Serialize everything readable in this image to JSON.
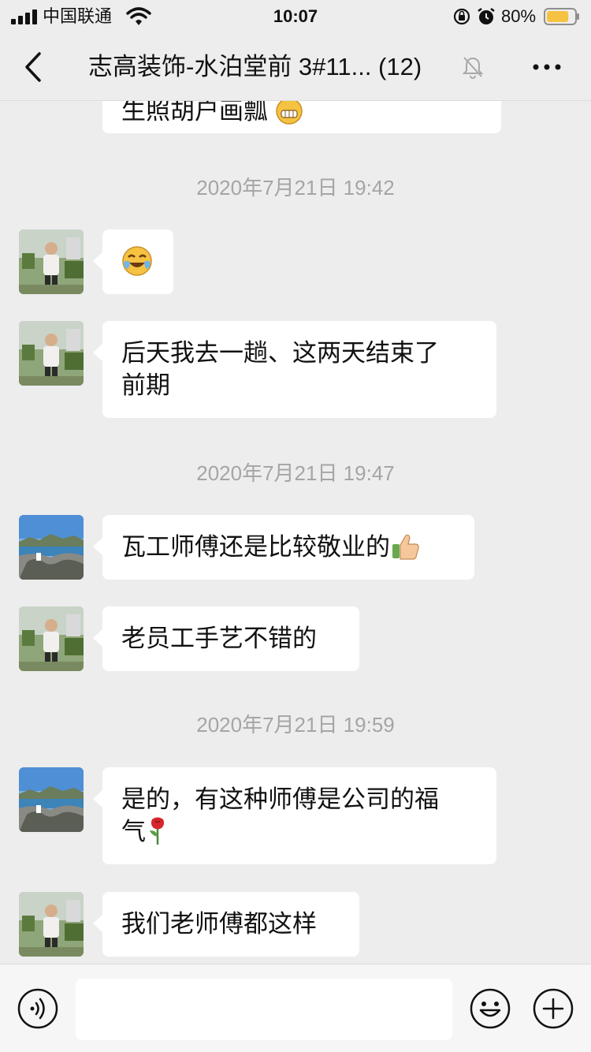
{
  "status_bar": {
    "carrier": "中国联通",
    "time": "10:07",
    "battery_percent": "80%",
    "battery_level": 0.8,
    "battery_color": "#f5c242"
  },
  "nav": {
    "title": "志高装饰-水泊堂前 3#11... (12)",
    "back_icon": "chevron-left-icon",
    "mute_icon": "bell-muted-icon",
    "more_icon": "more-dots-icon"
  },
  "messages": {
    "partial_top": {
      "text": "生照胡户画瓢",
      "emoji": "grin-emoji"
    },
    "ts1": "2020年7月21日 19:42",
    "m1": {
      "sender_avatar": "avatar-man",
      "emoji": "crying-laughing-emoji"
    },
    "m2": {
      "sender_avatar": "avatar-man",
      "line1": "后天我去一趟、这两天结束了",
      "line2": "前期"
    },
    "ts2": "2020年7月21日 19:47",
    "m3": {
      "sender_avatar": "avatar-seaside",
      "text": "瓦工师傅还是比较敬业的",
      "emoji": "thumbs-up-emoji"
    },
    "m4": {
      "sender_avatar": "avatar-man",
      "text": "老员工手艺不错的"
    },
    "ts3": "2020年7月21日 19:59",
    "m5": {
      "sender_avatar": "avatar-seaside",
      "line1": "是的，有这种师傅是公司的福",
      "line2": "气",
      "emoji": "rose-emoji"
    },
    "m6": {
      "sender_avatar": "avatar-man",
      "text": "我们老师傅都这样"
    }
  },
  "input_bar": {
    "voice_icon": "voice-icon",
    "emoji_icon": "emoji-face-icon",
    "plus_icon": "plus-circle-icon",
    "placeholder": ""
  }
}
